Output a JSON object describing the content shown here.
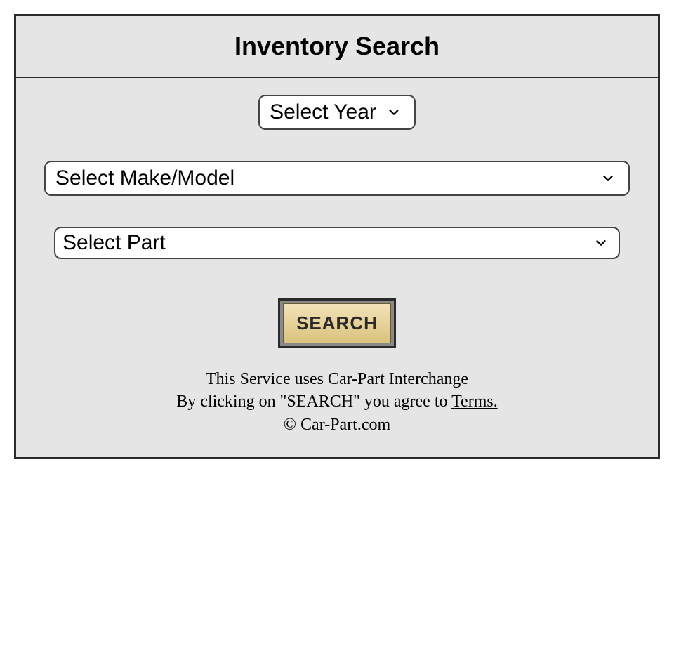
{
  "header": {
    "title": "Inventory Search"
  },
  "form": {
    "year": {
      "selected": "Select Year"
    },
    "make_model": {
      "selected": "Select Make/Model"
    },
    "part": {
      "selected": "Select Part"
    },
    "search_button_label": "SEARCH"
  },
  "footer": {
    "line1": "This Service uses Car-Part Interchange",
    "line2_prefix": "By clicking on \"SEARCH\" you agree to ",
    "terms_label": "Terms.",
    "copyright": "© Car-Part.com"
  }
}
